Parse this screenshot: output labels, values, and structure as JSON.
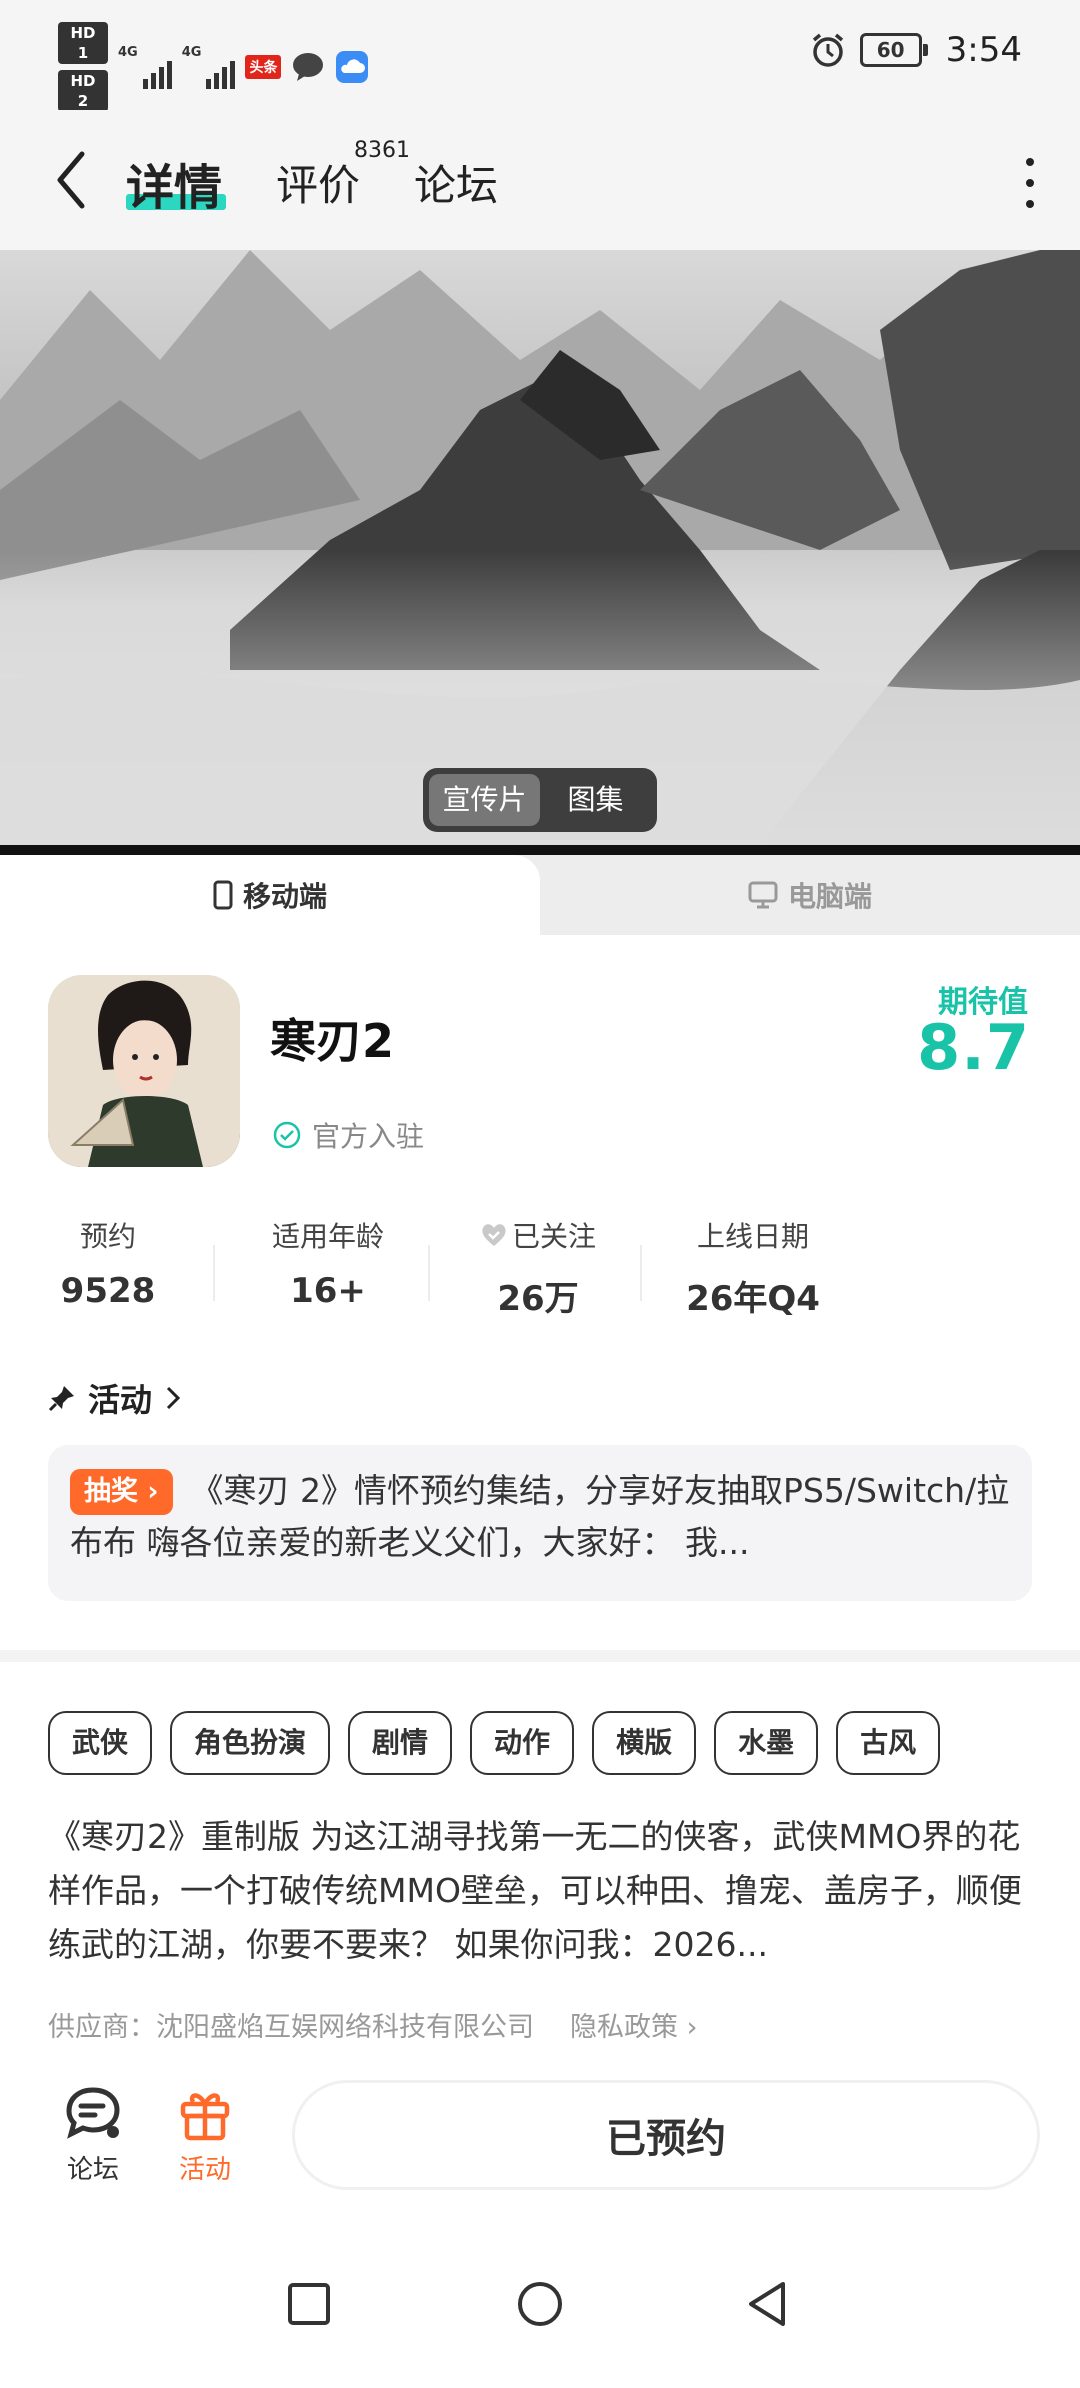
{
  "status_bar": {
    "sim1": "HD 1",
    "sim2": "HD 2",
    "network1": "4G",
    "network2": "4G",
    "battery": "60",
    "time": "3:54",
    "app_badge": "头条"
  },
  "nav": {
    "tab_details": "详情",
    "tab_reviews": "评价",
    "reviews_count": "8361",
    "tab_forum": "论坛"
  },
  "media": {
    "toggle_video": "宣传片",
    "toggle_gallery": "图集"
  },
  "platform": {
    "mobile": "移动端",
    "pc": "电脑端"
  },
  "game": {
    "title": "寒刃2",
    "official": "官方入驻",
    "score_label": "期待值",
    "score": "8.7",
    "stats": [
      {
        "label": "预约",
        "value": "9528"
      },
      {
        "label": "适用年龄",
        "value": "16+"
      },
      {
        "label": "已关注",
        "value": "26万"
      },
      {
        "label": "上线日期",
        "value": "26年Q4"
      }
    ]
  },
  "activity": {
    "heading": "活动",
    "badge": "抽奖",
    "text": "《寒刃 2》情怀预约集结，分享好友抽取PS5/Switch/拉布布 嗨各位亲爱的新老义父们，大家好： 我..."
  },
  "tags": [
    "武侠",
    "角色扮演",
    "剧情",
    "动作",
    "横版",
    "水墨",
    "古风"
  ],
  "description": "《寒刃2》重制版 为这江湖寻找第一无二的侠客，武侠MMO界的花样作品，一个打破传统MMO壁垒，可以种田、撸宠、盖房子，顺便练武的江湖，你要不要来？ 如果你问我：2026...",
  "supplier": {
    "text": "供应商：沈阳盛焰互娱网络科技有限公司",
    "privacy": "隐私政策"
  },
  "bottom": {
    "forum": "论坛",
    "activity": "活动",
    "reserve_button": "已预约"
  },
  "colors": {
    "accent": "#19c3a8",
    "tab_underline": "#2bd7c0",
    "orange": "#ff6a2b"
  }
}
